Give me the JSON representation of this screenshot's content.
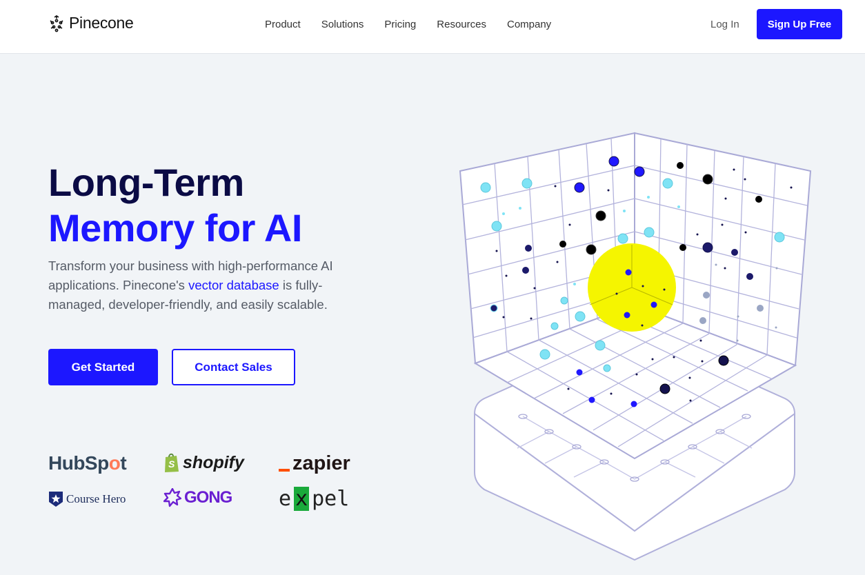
{
  "header": {
    "logo_text": "Pinecone",
    "logo_icon": "pinecone-icon",
    "nav": [
      {
        "label": "Product"
      },
      {
        "label": "Solutions"
      },
      {
        "label": "Pricing"
      },
      {
        "label": "Resources"
      },
      {
        "label": "Company"
      }
    ],
    "login_label": "Log In",
    "signup_label": "Sign Up Free"
  },
  "hero": {
    "title_line1": "Long-Term",
    "title_line2": "Memory for AI",
    "desc_before": "Transform your business with high-performance AI applications. Pinecone's ",
    "desc_link": "vector database",
    "desc_after": " is fully-managed, developer-friendly, and easily scalable.",
    "primary_button": "Get Started",
    "secondary_button": "Contact Sales"
  },
  "logos": {
    "hubspot_a": "HubSp",
    "hubspot_b": "o",
    "hubspot_c": "t",
    "shopify": "shopify",
    "zapier": "zapier",
    "coursehero": "Course Hero",
    "gong": "GONG",
    "expel_a": "e",
    "expel_x": "x",
    "expel_b": "pel"
  },
  "colors": {
    "brand_blue": "#1c17ff",
    "title_dark": "#0b0b45",
    "highlight_yellow": "#f5f500",
    "point_light": "#7fe3f5",
    "point_navy": "#14124e"
  }
}
